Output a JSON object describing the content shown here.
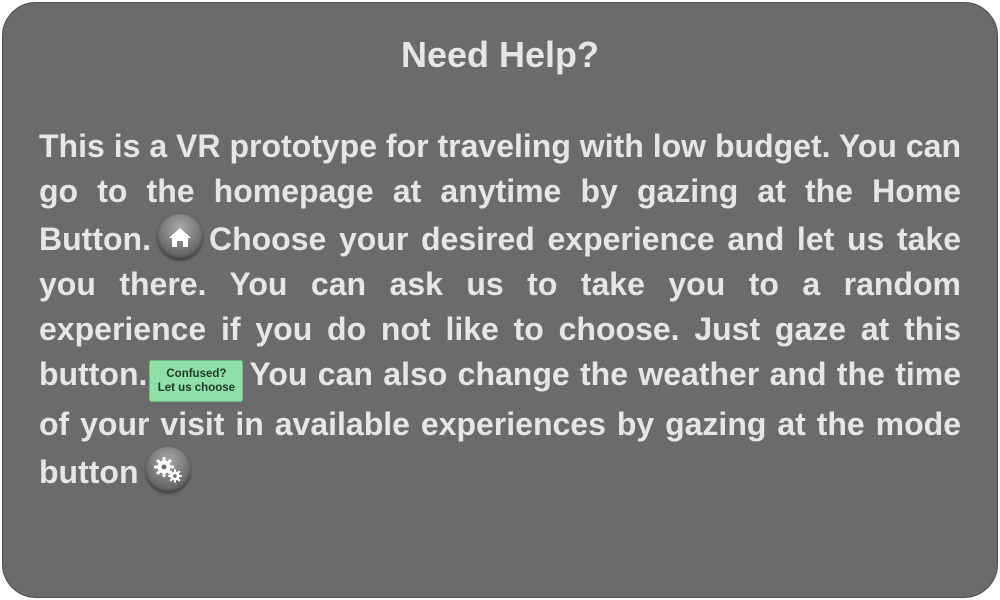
{
  "dialog": {
    "title": "Need Help?",
    "text_1": "This is a VR prototype for traveling with low budget. You can go to the homepage at anytime by gazing at the Home Button.",
    "text_2": "Choose your desired experi­ence and let us take you there. You can ask us to take you to a random experience if you do not like to choose. Just gaze at this button.",
    "text_3": "You can also change the weather and the time of your visit in avail­able experiences by gazing at the mode button",
    "home_icon": "home-icon",
    "mode_icon": "gears-icon",
    "random_button": {
      "line1": "Confused?",
      "line2": "Let us choose",
      "color": "#8ee0a8"
    }
  },
  "colors": {
    "panel_background": "#6b6b6b",
    "text": "#e6e6e6"
  }
}
